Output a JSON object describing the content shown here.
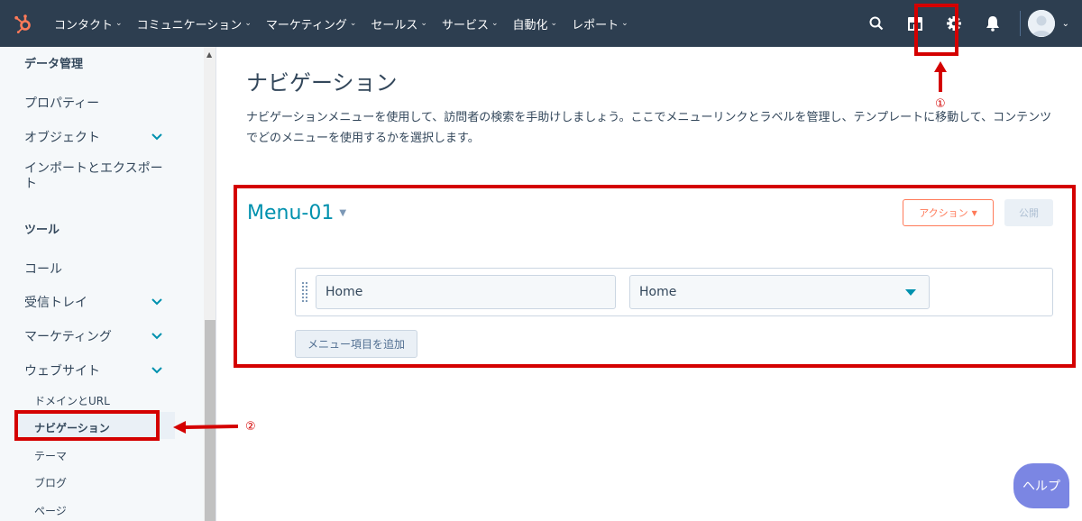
{
  "topnav": {
    "items": [
      {
        "label": "コンタクト"
      },
      {
        "label": "コミュニケーション"
      },
      {
        "label": "マーケティング"
      },
      {
        "label": "セールス"
      },
      {
        "label": "サービス"
      },
      {
        "label": "自動化"
      },
      {
        "label": "レポート"
      }
    ],
    "right_icons": [
      "search-icon",
      "marketplace-icon",
      "settings-gear-icon",
      "notifications-bell-icon",
      "user-avatar"
    ]
  },
  "sidebar": {
    "section_data_title": "データ管理",
    "items_data": [
      {
        "label": "プロパティー"
      },
      {
        "label": "オブジェクト"
      },
      {
        "label": "インポートとエクスポート",
        "line1": "インポートとエクスポー",
        "line2": "ト"
      }
    ],
    "section_tools_title": "ツール",
    "items_tools": [
      {
        "label": "コール"
      },
      {
        "label": "受信トレイ"
      },
      {
        "label": "マーケティング"
      },
      {
        "label": "ウェブサイト"
      }
    ],
    "website_sub": [
      {
        "label": "ドメインとURL"
      },
      {
        "label": "ナビゲーション"
      },
      {
        "label": "テーマ"
      },
      {
        "label": "ブログ"
      },
      {
        "label": "ページ"
      }
    ]
  },
  "main": {
    "title": "ナビゲーション",
    "description": "ナビゲーションメニューを使用して、訪問者の検索を手助けしましょう。ここでメニューリンクとラベルを管理し、テンプレートに移動して、コンテンツでどのメニューを使用するかを選択します。",
    "menu_name": "Menu-01",
    "action_button": "アクション",
    "publish_button": "公開",
    "menu_row": {
      "label_value": "Home",
      "link_value": "Home"
    },
    "add_item_button": "メニュー項目を追加"
  },
  "annotations": {
    "marker_1": "①",
    "marker_2": "②"
  },
  "help_button": "ヘルプ",
  "colors": {
    "nav_bg": "#2d3e50",
    "accent": "#0091ae",
    "action": "#ff7a59",
    "annotation": "#d40000"
  }
}
